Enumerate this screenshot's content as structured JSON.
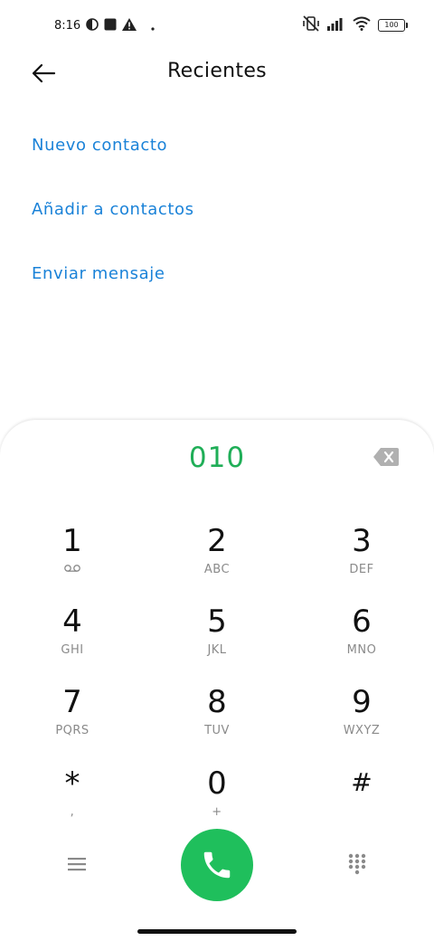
{
  "status_bar": {
    "time": "8:16",
    "battery": "100",
    "icons": [
      "data-saver-icon",
      "square-notification-icon",
      "alert-icon",
      "dot-icon",
      "vibrate-off-icon",
      "signal-icon",
      "wifi-icon",
      "battery-icon"
    ]
  },
  "header": {
    "title": "Recientes",
    "back_icon": "back-arrow-icon"
  },
  "actions": {
    "new_contact": "Nuevo contacto",
    "add_to_contacts": "Añadir a contactos",
    "send_message": "Enviar mensaje"
  },
  "dialer": {
    "number": "010",
    "backspace_icon": "backspace-icon",
    "keys": [
      {
        "digit": "1",
        "letters": ""
      },
      {
        "digit": "2",
        "letters": "ABC"
      },
      {
        "digit": "3",
        "letters": "DEF"
      },
      {
        "digit": "4",
        "letters": "GHI"
      },
      {
        "digit": "5",
        "letters": "JKL"
      },
      {
        "digit": "6",
        "letters": "MNO"
      },
      {
        "digit": "7",
        "letters": "PQRS"
      },
      {
        "digit": "8",
        "letters": "TUV"
      },
      {
        "digit": "9",
        "letters": "WXYZ"
      },
      {
        "digit": "*",
        "letters": ","
      },
      {
        "digit": "0",
        "letters": "+"
      },
      {
        "digit": "#",
        "letters": ""
      }
    ],
    "voicemail_icon": "voicemail-icon",
    "menu_icon": "menu-icon",
    "call_icon": "phone-icon",
    "keypad_icon": "keypad-icon"
  },
  "colors": {
    "accent_link": "#1a82d8",
    "number_green": "#1fae57",
    "call_green": "#1fbf5c"
  }
}
